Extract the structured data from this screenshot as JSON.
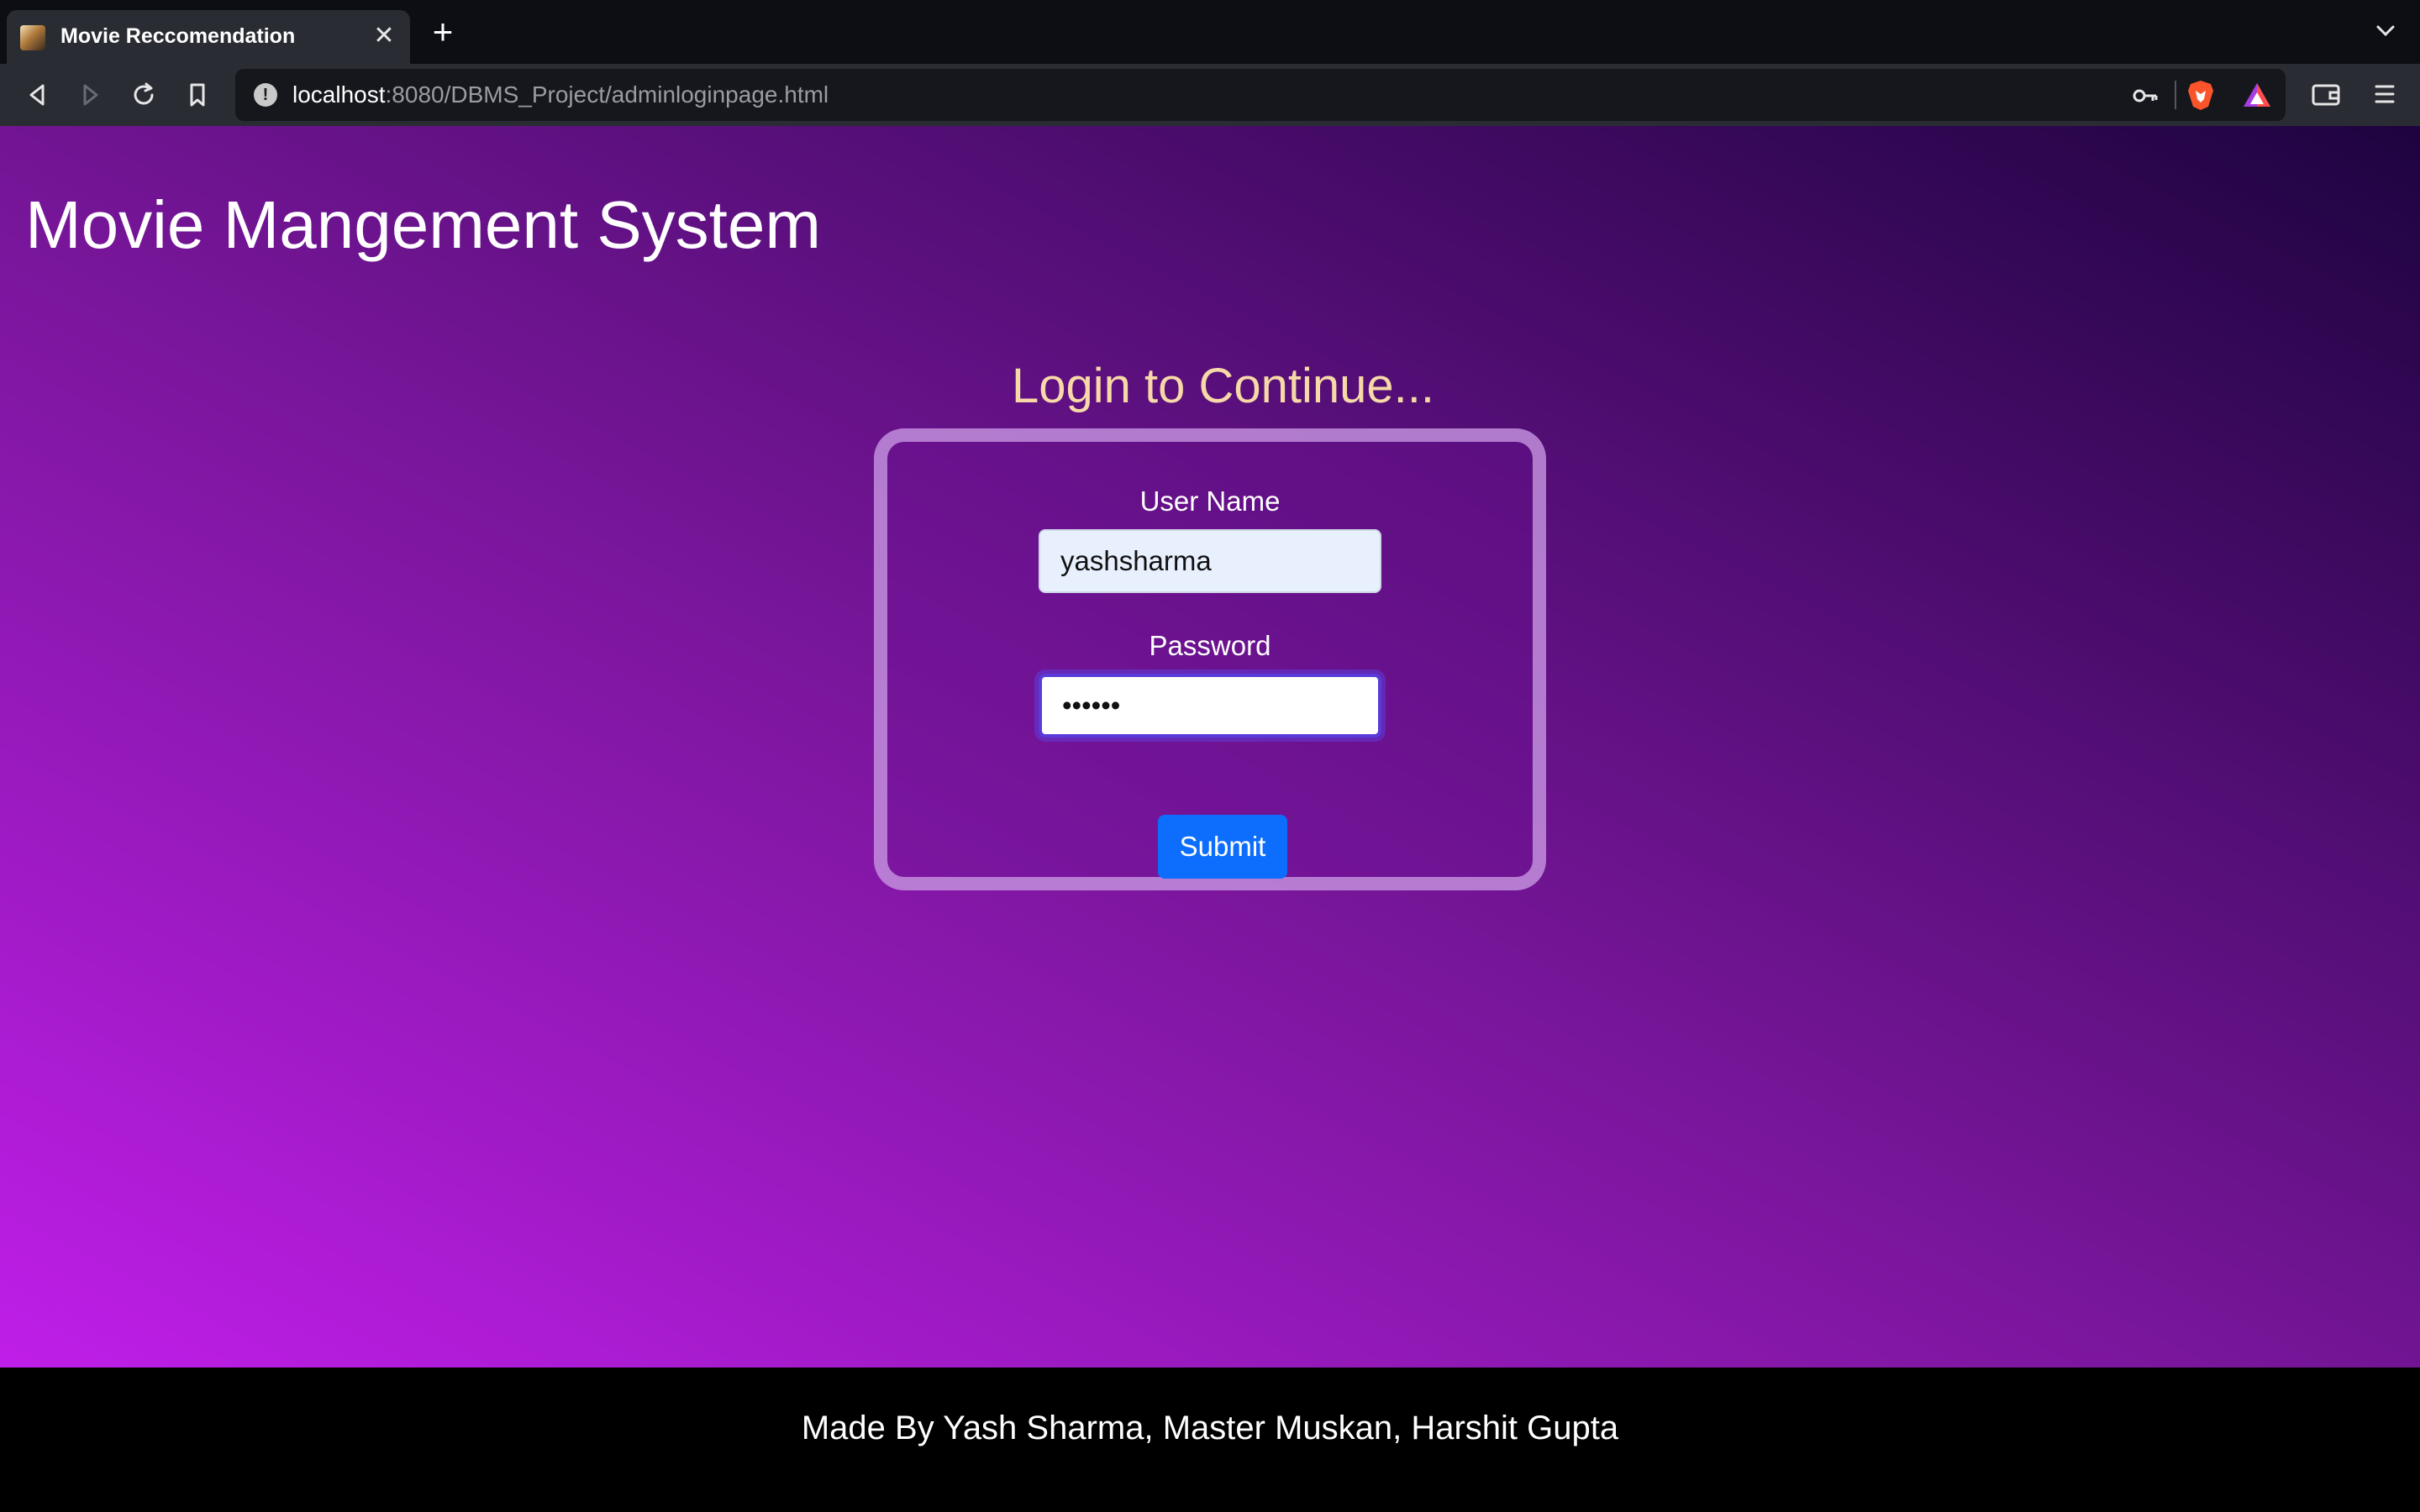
{
  "browser": {
    "tab": {
      "title": "Movie Reccomendation",
      "close_glyph": "✕",
      "favicon": "movie-favicon-icon"
    },
    "new_tab_glyph": "+",
    "address": {
      "host": "localhost",
      "path": ":8080/DBMS_Project/adminloginpage.html",
      "info_glyph": "!"
    },
    "icons": [
      "back-icon",
      "forward-icon",
      "reload-icon",
      "bookmark-icon",
      "key-icon",
      "brave-shields-icon",
      "brave-rewards-icon",
      "wallet-icon",
      "menu-icon",
      "tab-list-chevron-icon"
    ]
  },
  "page": {
    "site_title": "Movie Mangement System",
    "login": {
      "heading": "Login to Continue...",
      "username_label": "User Name",
      "username_value": "yashsharma",
      "password_label": "Password",
      "password_value": "••••••",
      "submit_label": "Submit"
    },
    "footer": {
      "text": "Made By Yash Sharma, Master Muskan, Harshit Gupta"
    }
  },
  "colors": {
    "gradient_start": "#bf1ee8",
    "gradient_end": "#1e0340",
    "heading": "#f7d9a8",
    "submit": "#0d6efd",
    "footer_bg": "#000000"
  }
}
